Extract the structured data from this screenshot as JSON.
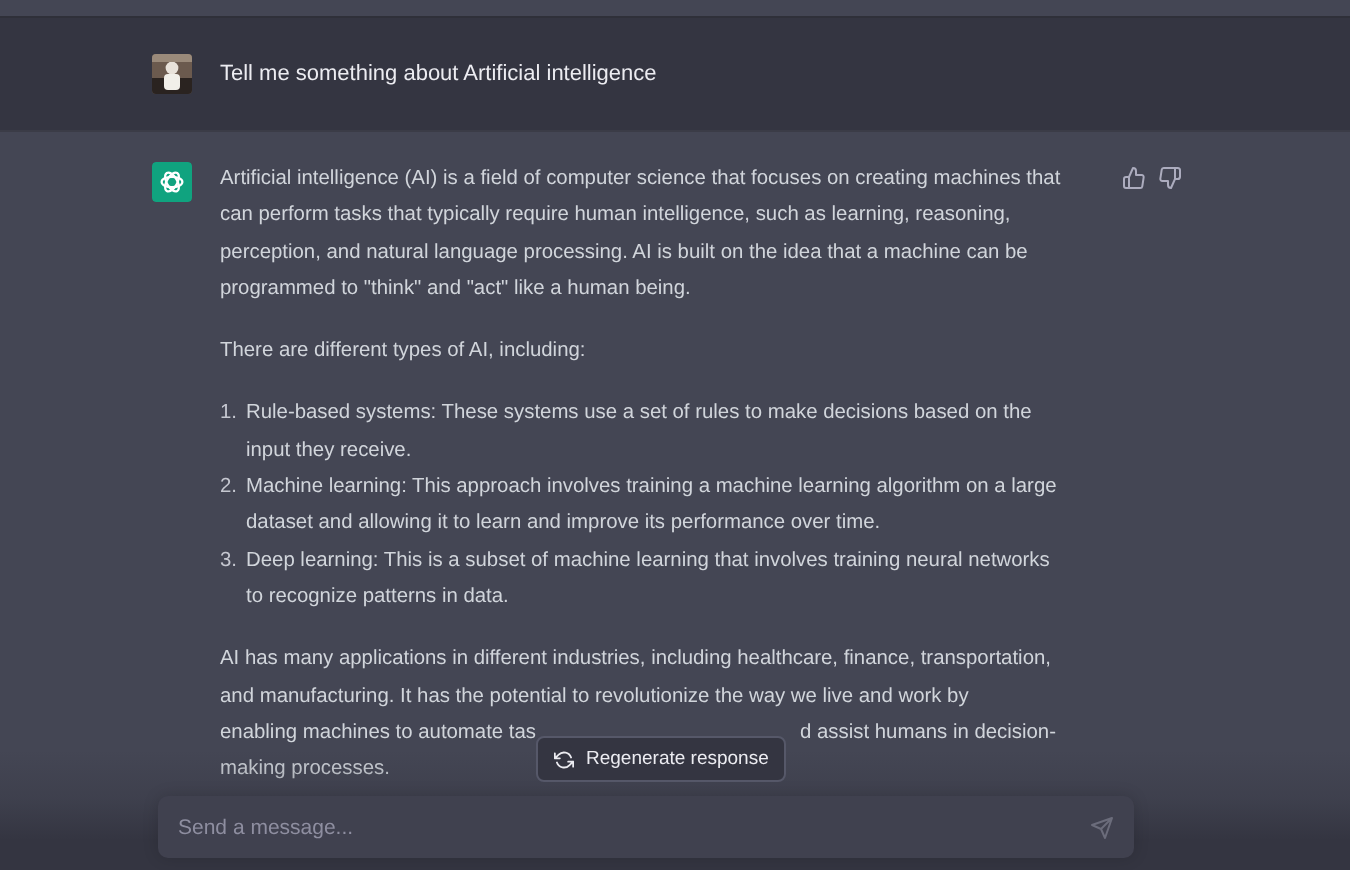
{
  "user_message": {
    "text": "Tell me something about Artificial intelligence"
  },
  "assistant_message": {
    "intro": "Artificial intelligence (AI) is a field of computer science that focuses on creating machines that can perform tasks that typically require human intelligence, such as learning, reasoning, perception, and natural language processing. AI is built on the idea that a machine can be programmed to \"think\" and \"act\" like a human being.",
    "lead": "There are different types of AI, including:",
    "list": [
      {
        "number": "1.",
        "text": "Rule-based systems: These systems use a set of rules to make decisions based on the input they receive."
      },
      {
        "number": "2.",
        "text": "Machine learning: This approach involves training a machine learning algorithm on a large dataset and allowing it to learn and improve its performance over time."
      },
      {
        "number": "3.",
        "text": "Deep learning: This is a subset of machine learning that involves training neural networks to recognize patterns in data."
      }
    ],
    "closing_lines": [
      [
        "AI has many applications in different industries, including healthcare, finance, transportation,"
      ],
      [
        "and manufacturing. It has the potential to revolutionize the way we live and work by"
      ],
      [
        "enabling machines to automate tas",
        "d assist humans in decision-"
      ],
      [
        "making processes."
      ]
    ]
  },
  "regenerate_button": {
    "label": "Regenerate response"
  },
  "composer": {
    "placeholder": "Send a message..."
  }
}
